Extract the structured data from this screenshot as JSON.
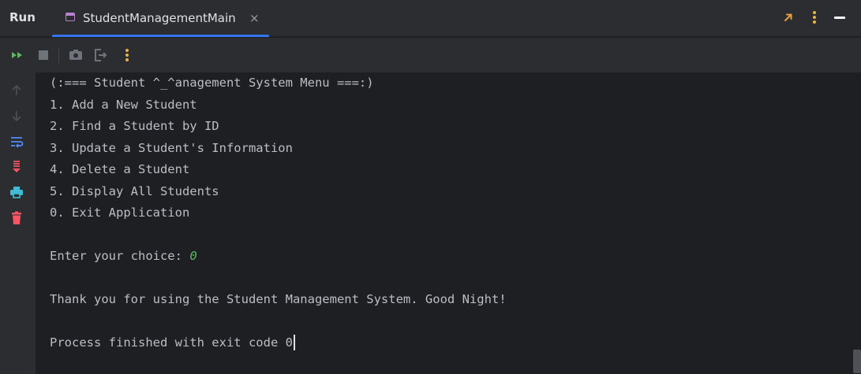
{
  "header": {
    "run_label": "Run",
    "tab": {
      "title": "StudentManagementMain",
      "close_glyph": "×"
    },
    "actions": [
      "maximize-icon",
      "more-options-icon",
      "minimize-icon"
    ]
  },
  "toolbar": {
    "buttons": [
      "rerun-icon",
      "stop-icon",
      "screenshot-icon",
      "exit-icon",
      "more-icon"
    ]
  },
  "gutter": {
    "buttons": [
      "up-arrow-icon",
      "down-arrow-icon",
      "soft-wrap-icon",
      "scroll-to-end-icon",
      "print-icon",
      "clear-icon"
    ]
  },
  "console": {
    "menu_title": "(:=== Student ^_^anagement System Menu ===:)",
    "options": [
      "1. Add a New Student",
      "2. Find a Student by ID",
      "3. Update a Student's Information",
      "4. Delete a Student",
      "5. Display All Students",
      "0. Exit Application"
    ],
    "prompt": "Enter your choice: ",
    "choice": "0",
    "goodbye": "Thank you for using the Student Management System. Good Night!",
    "exit_message": "Process finished with exit code 0"
  },
  "colors": {
    "accent": "#3574f0",
    "input_text": "#5fb85f",
    "console_text": "#bcbec4"
  }
}
